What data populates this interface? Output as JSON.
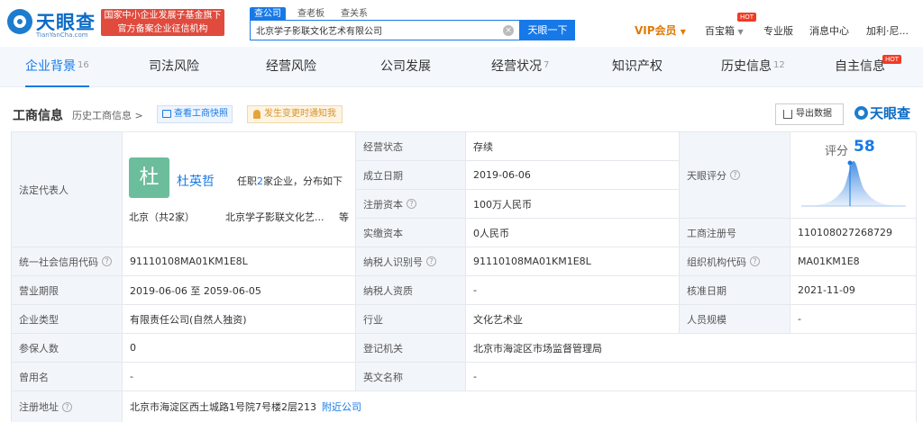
{
  "header": {
    "logo_text": "天眼查",
    "logo_domain": "TianYanCha.com",
    "badge_line1": "国家中小企业发展子基金旗下",
    "badge_line2": "官方备案企业征信机构",
    "search_tabs": [
      "查公司",
      "查老板",
      "查关系"
    ],
    "search_value": "北京学子影联文化艺术有限公司",
    "search_button": "天眼一下",
    "vip_label": "VIP会员",
    "baibaoxiang": "百宝箱",
    "hot": "HOT",
    "pro": "专业版",
    "messages": "消息中心",
    "user": "加利·尼..."
  },
  "tabs": [
    {
      "label": "企业背景",
      "count": "16"
    },
    {
      "label": "司法风险",
      "count": ""
    },
    {
      "label": "经营风险",
      "count": ""
    },
    {
      "label": "公司发展",
      "count": ""
    },
    {
      "label": "经营状况",
      "count": "7"
    },
    {
      "label": "知识产权",
      "count": ""
    },
    {
      "label": "历史信息",
      "count": "12"
    },
    {
      "label": "自主信息",
      "count": ""
    }
  ],
  "section": {
    "title": "工商信息",
    "history": "历史工商信息 >",
    "snapshot": "查看工商快照",
    "notify": "发生变更时通知我",
    "export": "导出数据",
    "brand": "天眼查"
  },
  "rep": {
    "label": "法定代表人",
    "avatar": "杜",
    "name": "杜英哲",
    "info_prefix": "任职",
    "info_count": "2",
    "info_suffix": "家企业，分布如下",
    "location": "北京（共2家）",
    "company": "北京学子影联文化艺...",
    "etc": "等"
  },
  "fields": {
    "status_label": "经营状态",
    "status": "存续",
    "founded_label": "成立日期",
    "founded": "2019-06-06",
    "capital_label": "注册资本",
    "capital": "100万人民币",
    "paid_label": "实缴资本",
    "paid": "0人民币",
    "score_label": "天眼评分",
    "score_text": "评分",
    "score": "58",
    "regno_label": "工商注册号",
    "regno": "110108027268729",
    "credit_label": "统一社会信用代码",
    "credit": "91110108MA01KM1E8L",
    "taxid_label": "纳税人识别号",
    "taxid": "91110108MA01KM1E8L",
    "orgcode_label": "组织机构代码",
    "orgcode": "MA01KM1E8",
    "term_label": "营业期限",
    "term": "2019-06-06 至 2059-06-05",
    "taxpayer_label": "纳税人资质",
    "taxpayer": "-",
    "approve_label": "核准日期",
    "approve": "2021-11-09",
    "type_label": "企业类型",
    "type": "有限责任公司(自然人独资)",
    "industry_label": "行业",
    "industry": "文化艺术业",
    "staff_label": "人员规模",
    "staff": "-",
    "insured_label": "参保人数",
    "insured": "0",
    "authority_label": "登记机关",
    "authority": "北京市海淀区市场监督管理局",
    "former_label": "曾用名",
    "former": "-",
    "english_label": "英文名称",
    "english": "-",
    "address_label": "注册地址",
    "address": "北京市海淀区西土城路1号院7号楼2层213",
    "nearby": "附近公司"
  },
  "colors": {
    "accent": "#1779e8",
    "badge": "#e04b3e",
    "vip": "#e07a08",
    "avatar": "#6cbd9c"
  }
}
